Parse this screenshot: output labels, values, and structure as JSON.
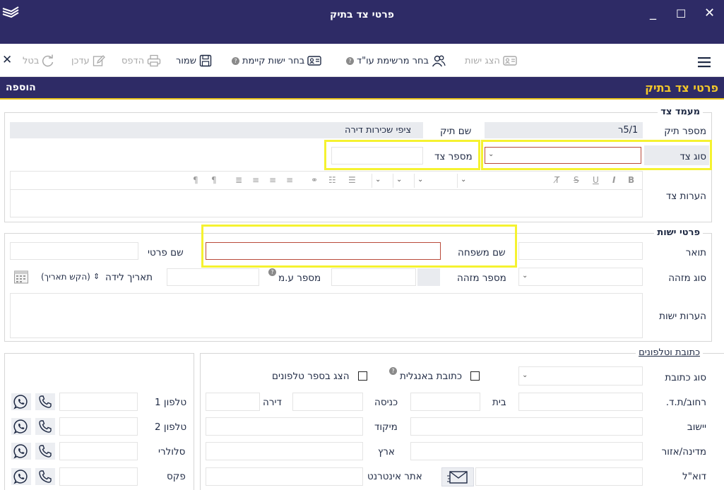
{
  "window": {
    "title": "פרטי צד בתיק",
    "minimize": "_",
    "maximize": "☐",
    "close": "✕"
  },
  "toolbar": {
    "show_entity": "הצג ישות",
    "choose_lawyer": "בחר מרשימת עו\"ד",
    "choose_entity": "בחר ישות קיימת",
    "save": "שמור",
    "print": "הדפס",
    "update": "עדכן",
    "cancel": "בטל",
    "close_x": "✕",
    "help": "?"
  },
  "header": {
    "title": "פרטי צד בתיק",
    "mode": "הוספה"
  },
  "party_status": {
    "legend": "מעמד צד",
    "case_number_label": "מספר תיק",
    "case_number_value": "5/1ר",
    "case_name_label": "שם תיק",
    "case_name_value": "ציפי שכירות דירה",
    "party_type_label": "סוג צד",
    "party_number_label": "מספר צד",
    "party_notes_label": "הערות צד"
  },
  "entity": {
    "legend": "פרטי ישות",
    "title_label": "תואר",
    "last_name_label": "שם משפחה",
    "first_name_label": "שם פרטי",
    "id_type_label": "סוג מזהה",
    "id_number_label": "מספר מזהה",
    "vat_label": "מספר ע.מ",
    "birth_date_label": "תאריך לידה",
    "birth_date_placeholder": "(הקש תאריך)",
    "notes_label": "הערות ישות"
  },
  "address": {
    "legend": "כתובת וטלפונים",
    "address_type_label": "סוג כתובת",
    "english_address_label": "כתובת באנגלית",
    "phonebook_label": "הצג בספר טלפונים",
    "street_label": "רחוב/ת.ד.",
    "house_label": "בית",
    "entrance_label": "כניסה",
    "apartment_label": "דירה",
    "city_label": "יישוב",
    "zip_label": "מיקוד",
    "region_label": "מדינה/אזור",
    "country_label": "ארץ",
    "email_label": "דוא\"ל",
    "website_label": "אתר אינטרנט"
  },
  "phones": {
    "phone1_label": "טלפון 1",
    "phone2_label": "טלפון 2",
    "mobile_label": "סלולרי",
    "fax_label": "פקס"
  },
  "colors": {
    "brand": "#2e2b66",
    "accent": "#f2c72a",
    "highlight": "#f5f230"
  }
}
